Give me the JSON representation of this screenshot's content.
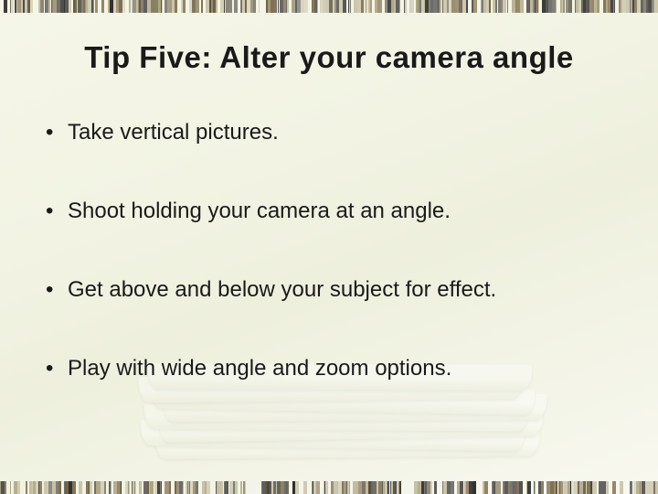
{
  "slide": {
    "title": "Tip Five: Alter your camera angle",
    "bullets": [
      "Take vertical pictures.",
      "Shoot holding your camera at an angle.",
      "Get above and below your subject for effect.",
      "Play with wide angle and zoom options."
    ]
  },
  "decor": {
    "barcode_colors": [
      "#5b4a3a",
      "#c8c2a8",
      "#8a7a5a",
      "#2e2e2e",
      "#d0ccb0",
      "#7a6a4a",
      "#3a3a3a",
      "#b8b090",
      "#6a5a3a",
      "#444",
      "#c4bfa4",
      "#847452",
      "#333",
      "#bdb798",
      "#918160",
      "#2a2a2a",
      "#cfc9ad",
      "#766644",
      "#3e3e3e",
      "#b2aa88",
      "#5f502f",
      "#474747",
      "#c1ba9c",
      "#aba380"
    ]
  }
}
